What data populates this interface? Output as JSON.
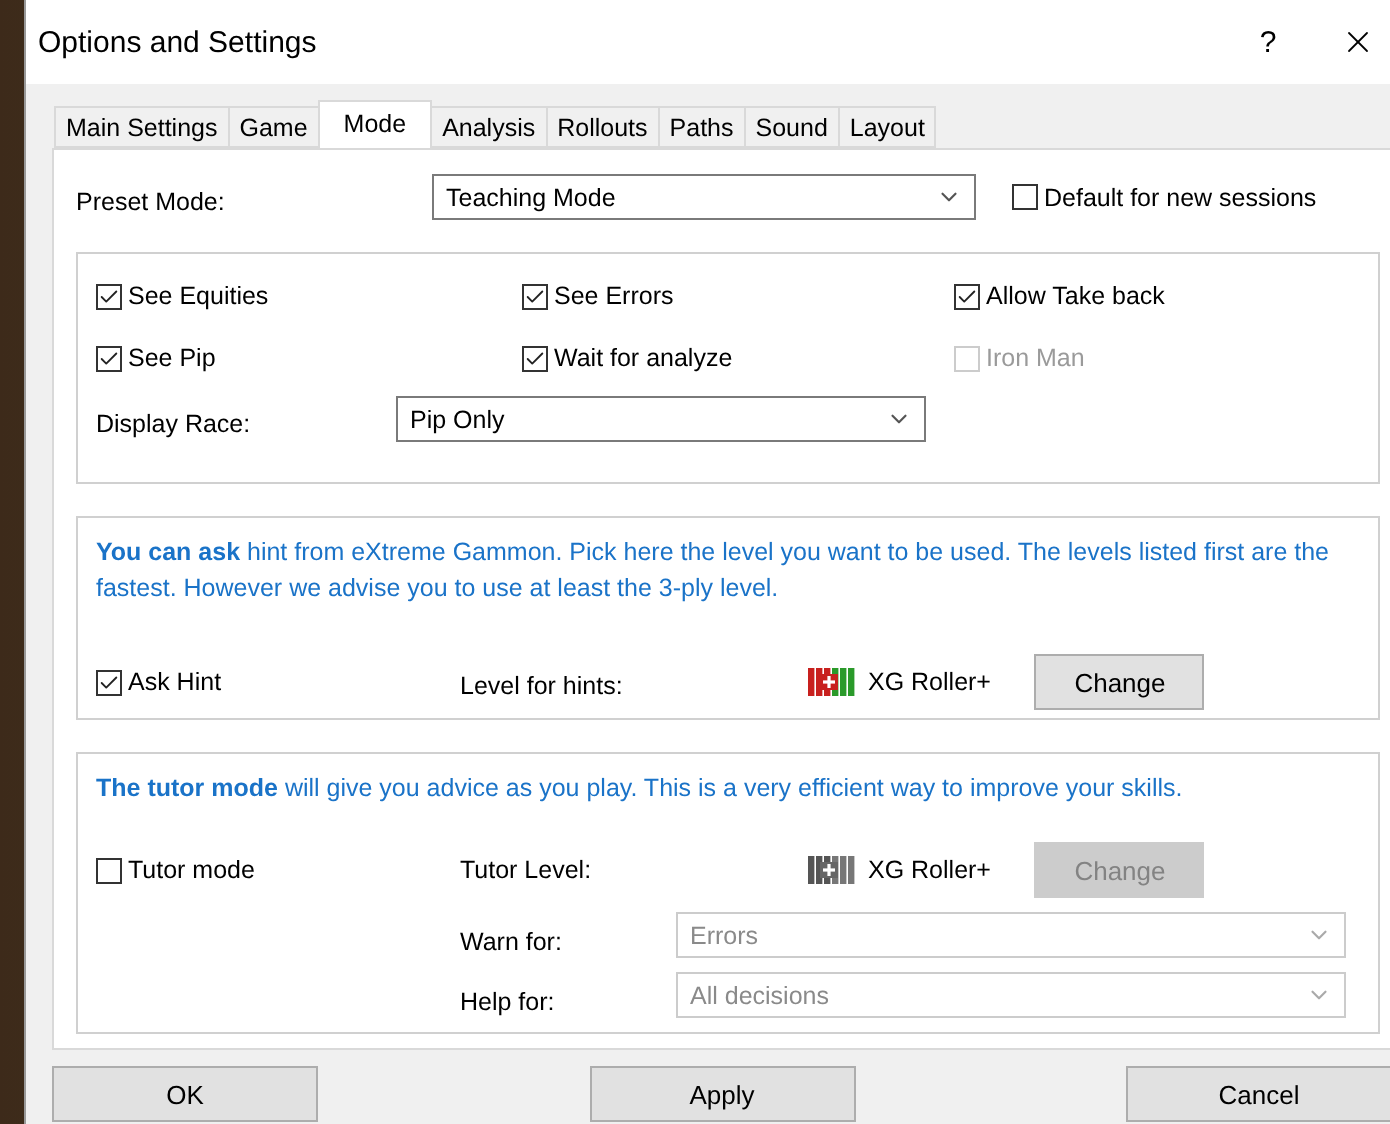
{
  "window": {
    "title": "Options and Settings",
    "help": "?"
  },
  "tabs": [
    {
      "label": "Main Settings",
      "selected": false
    },
    {
      "label": "Game",
      "selected": false
    },
    {
      "label": "Mode",
      "selected": true
    },
    {
      "label": "Analysis",
      "selected": false
    },
    {
      "label": "Rollouts",
      "selected": false
    },
    {
      "label": "Paths",
      "selected": false
    },
    {
      "label": "Sound",
      "selected": false
    },
    {
      "label": "Layout",
      "selected": false
    }
  ],
  "preset": {
    "label": "Preset Mode:",
    "value": "Teaching Mode",
    "default_checkbox": {
      "label": "Default for new sessions",
      "checked": false
    }
  },
  "options": [
    {
      "label": "See Equities",
      "checked": true,
      "disabled": false
    },
    {
      "label": "See Errors",
      "checked": true,
      "disabled": false
    },
    {
      "label": "Allow Take back",
      "checked": true,
      "disabled": false
    },
    {
      "label": "See Pip",
      "checked": true,
      "disabled": false
    },
    {
      "label": "Wait for analyze",
      "checked": true,
      "disabled": false
    },
    {
      "label": "Iron Man",
      "checked": false,
      "disabled": true
    }
  ],
  "display_race": {
    "label": "Display Race:",
    "value": "Pip Only"
  },
  "hint": {
    "description": "**You can ask** hint from eXtreme Gammon. Pick here the level you want to be used. The levels listed first are the fastest. However we advise you to use at least the 3-ply level.",
    "checkbox": {
      "label": "Ask Hint",
      "checked": true
    },
    "level_label": "Level for hints:",
    "engine": "XG Roller+",
    "change": {
      "label": "Change",
      "disabled": false
    }
  },
  "tutor": {
    "description": "**The tutor mode** will give you advice as you play. This is a very efficient way to improve your skills.",
    "checkbox": {
      "label": "Tutor mode",
      "checked": false
    },
    "level_label": "Tutor Level:",
    "engine": "XG Roller+",
    "change": {
      "label": "Change",
      "disabled": true
    },
    "selects": [
      {
        "label": "Warn for:",
        "value": "Errors",
        "disabled": true
      },
      {
        "label": "Help for:",
        "value": "All decisions",
        "disabled": true
      }
    ]
  },
  "buttons": [
    "OK",
    "Apply",
    "Cancel"
  ]
}
